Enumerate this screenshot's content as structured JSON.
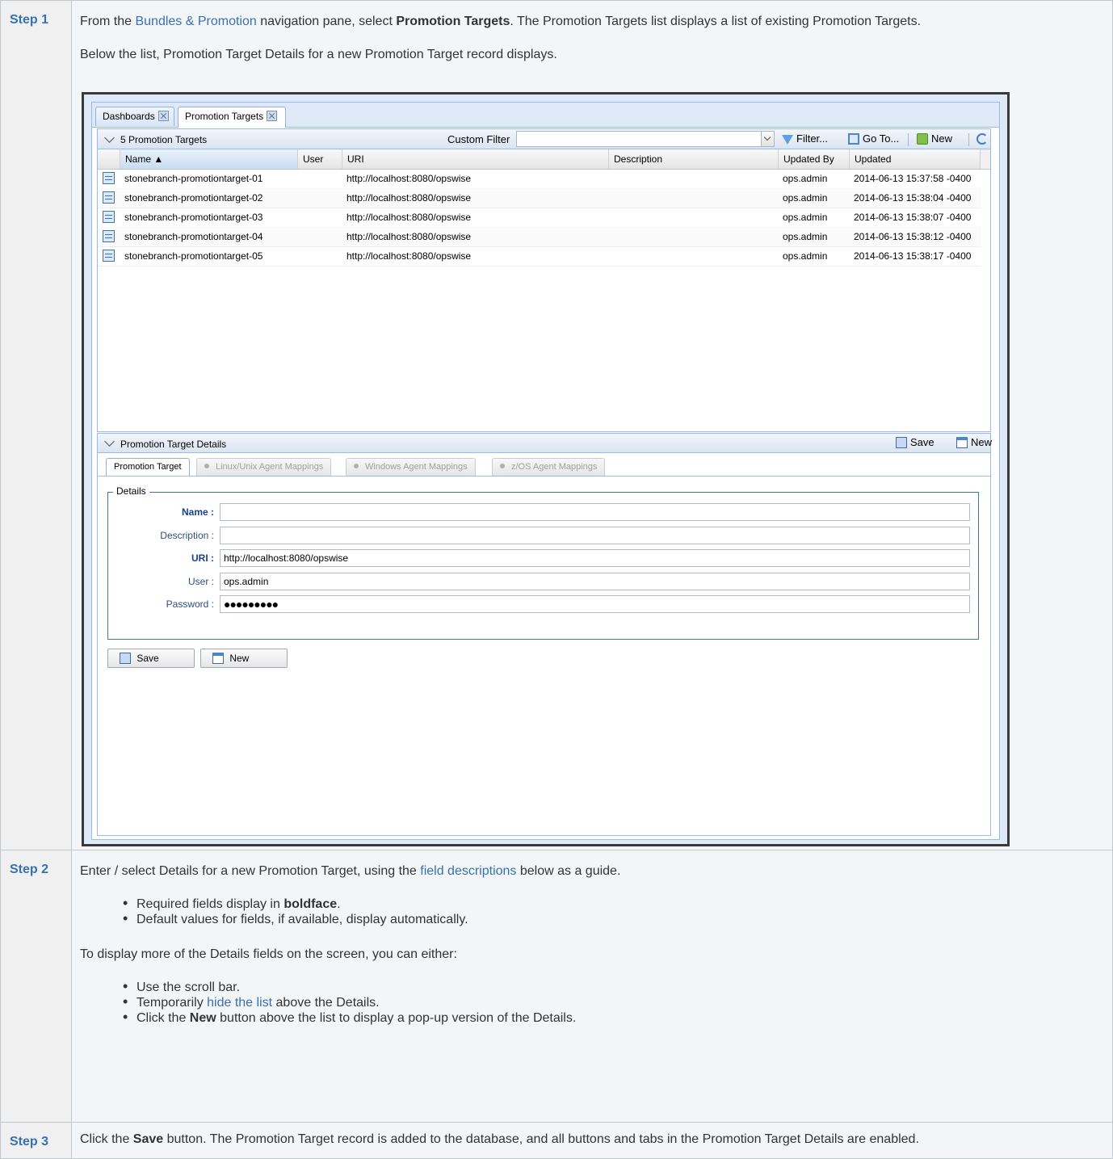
{
  "steps": [
    {
      "label": "Step 1",
      "p1_pre": "From the ",
      "p1_link": "Bundles & Promotion",
      "p1_mid": " navigation pane, select ",
      "p1_bold": "Promotion Targets",
      "p1_post": ". The Promotion Targets list displays a list of existing Promotion Targets.",
      "p2": "Below the list, Promotion Target Details for a new Promotion Target record displays."
    },
    {
      "label": "Step 2",
      "p1_pre": "Enter / select Details for a new Promotion Target, using the ",
      "p1_link": "field descriptions",
      "p1_post": " below as a guide.",
      "bullet1_pre": "Required fields display in ",
      "bullet1_bold": "boldface",
      "bullet1_post": ".",
      "bullet2": "Default values for fields, if available, display automatically.",
      "p2": "To display more of the Details fields on the screen, you can either:",
      "opt1": "Use the scroll bar.",
      "opt2_pre": "Temporarily ",
      "opt2_link": "hide the list",
      "opt2_post": " above the Details.",
      "opt3_pre": "Click the ",
      "opt3_bold": "New",
      "opt3_post": " button above the list to display a pop-up version of the Details."
    },
    {
      "label": "Step 3",
      "p1_pre": "Click the ",
      "p1_bold": "Save",
      "p1_post": " button. The Promotion Target record is added to the database, and all buttons and tabs in the Promotion Target Details are enabled."
    }
  ],
  "app": {
    "tabs": [
      "Dashboards",
      "Promotion Targets"
    ],
    "list": {
      "title": "5 Promotion Targets",
      "custom_filter_label": "Custom Filter",
      "custom_filter_value": "",
      "toolbar": {
        "filter": "Filter...",
        "goto": "Go To...",
        "new": "New"
      },
      "columns": [
        "Name",
        "User",
        "URI",
        "Description",
        "Updated By",
        "Updated"
      ],
      "rows": [
        [
          "stonebranch-promotiontarget-01",
          "",
          "http://localhost:8080/opswise",
          "",
          "ops.admin",
          "2014-06-13 15:37:58 -0400"
        ],
        [
          "stonebranch-promotiontarget-02",
          "",
          "http://localhost:8080/opswise",
          "",
          "ops.admin",
          "2014-06-13 15:38:04 -0400"
        ],
        [
          "stonebranch-promotiontarget-03",
          "",
          "http://localhost:8080/opswise",
          "",
          "ops.admin",
          "2014-06-13 15:38:07 -0400"
        ],
        [
          "stonebranch-promotiontarget-04",
          "",
          "http://localhost:8080/opswise",
          "",
          "ops.admin",
          "2014-06-13 15:38:12 -0400"
        ],
        [
          "stonebranch-promotiontarget-05",
          "",
          "http://localhost:8080/opswise",
          "",
          "ops.admin",
          "2014-06-13 15:38:17 -0400"
        ]
      ]
    },
    "details": {
      "title": "Promotion Target Details",
      "save": "Save",
      "new": "New",
      "tabs": [
        "Promotion Target",
        "Linux/Unix Agent Mappings",
        "Windows Agent Mappings",
        "z/OS Agent Mappings"
      ],
      "legend": "Details",
      "fields": {
        "name_label": "Name :",
        "name_value": "",
        "description_label": "Description :",
        "description_value": "",
        "uri_label": "URI :",
        "uri_value": "http://localhost:8080/opswise",
        "user_label": "User :",
        "user_value": "ops.admin",
        "password_label": "Password :",
        "password_value": "●●●●●●●●●"
      },
      "buttons": {
        "save": "Save",
        "new": "New"
      }
    }
  }
}
